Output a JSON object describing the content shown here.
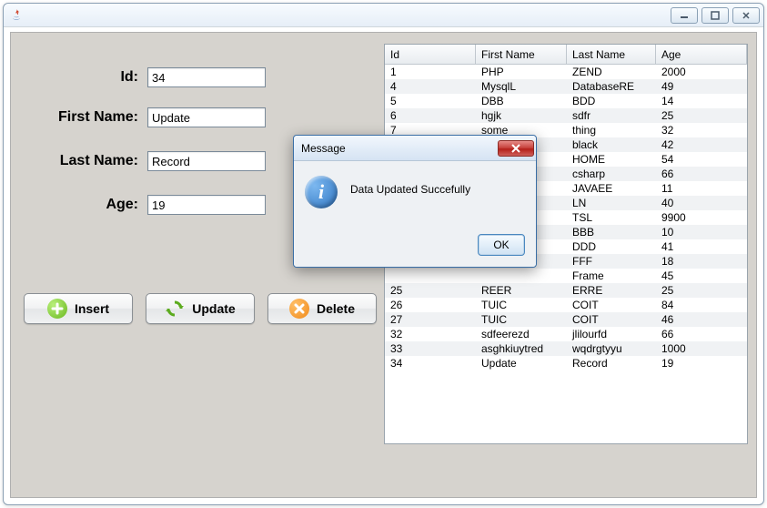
{
  "window": {
    "title": ""
  },
  "form": {
    "labels": {
      "id": "Id:",
      "firstName": "First Name:",
      "lastName": "Last Name:",
      "age": "Age:"
    },
    "values": {
      "id": "34",
      "firstName": "Update",
      "lastName": "Record",
      "age": "19"
    }
  },
  "buttons": {
    "insert": "Insert",
    "update": "Update",
    "delete": "Delete"
  },
  "table": {
    "headers": {
      "id": "Id",
      "firstName": "First Name",
      "lastName": "Last Name",
      "age": "Age"
    },
    "rows": [
      {
        "id": "1",
        "firstName": "PHP",
        "lastName": "ZEND",
        "age": "2000"
      },
      {
        "id": "4",
        "firstName": "MysqlL",
        "lastName": "DatabaseRE",
        "age": "49"
      },
      {
        "id": "5",
        "firstName": "DBB",
        "lastName": "BDD",
        "age": "14"
      },
      {
        "id": "6",
        "firstName": "hgjk",
        "lastName": "sdfr",
        "age": "25"
      },
      {
        "id": "7",
        "firstName": "some",
        "lastName": "thing",
        "age": "32"
      },
      {
        "id": "",
        "firstName": "",
        "lastName": "black",
        "age": "42"
      },
      {
        "id": "",
        "firstName": "",
        "lastName": "HOME",
        "age": "54"
      },
      {
        "id": "",
        "firstName": "",
        "lastName": "csharp",
        "age": "66"
      },
      {
        "id": "",
        "firstName": "",
        "lastName": "JAVAEE",
        "age": "11"
      },
      {
        "id": "",
        "firstName": "",
        "lastName": "LN",
        "age": "40"
      },
      {
        "id": "",
        "firstName": "",
        "lastName": "TSL",
        "age": "9900"
      },
      {
        "id": "",
        "firstName": "",
        "lastName": "BBB",
        "age": "10"
      },
      {
        "id": "",
        "firstName": "",
        "lastName": "DDD",
        "age": "41"
      },
      {
        "id": "",
        "firstName": "",
        "lastName": "FFF",
        "age": "18"
      },
      {
        "id": "",
        "firstName": "",
        "lastName": "Frame",
        "age": "45"
      },
      {
        "id": "25",
        "firstName": "REER",
        "lastName": "ERRE",
        "age": "25"
      },
      {
        "id": "26",
        "firstName": "TUIC",
        "lastName": "COIT",
        "age": "84"
      },
      {
        "id": "27",
        "firstName": "TUIC",
        "lastName": "COIT",
        "age": "46"
      },
      {
        "id": "32",
        "firstName": "sdfeerezd",
        "lastName": "jlilourfd",
        "age": "66"
      },
      {
        "id": "33",
        "firstName": "asghkiuytred",
        "lastName": "wqdrgtyyu",
        "age": "1000"
      },
      {
        "id": "34",
        "firstName": "Update",
        "lastName": "Record",
        "age": "19"
      }
    ]
  },
  "dialog": {
    "title": "Message",
    "text": "Data Updated Succefully",
    "ok": "OK"
  }
}
